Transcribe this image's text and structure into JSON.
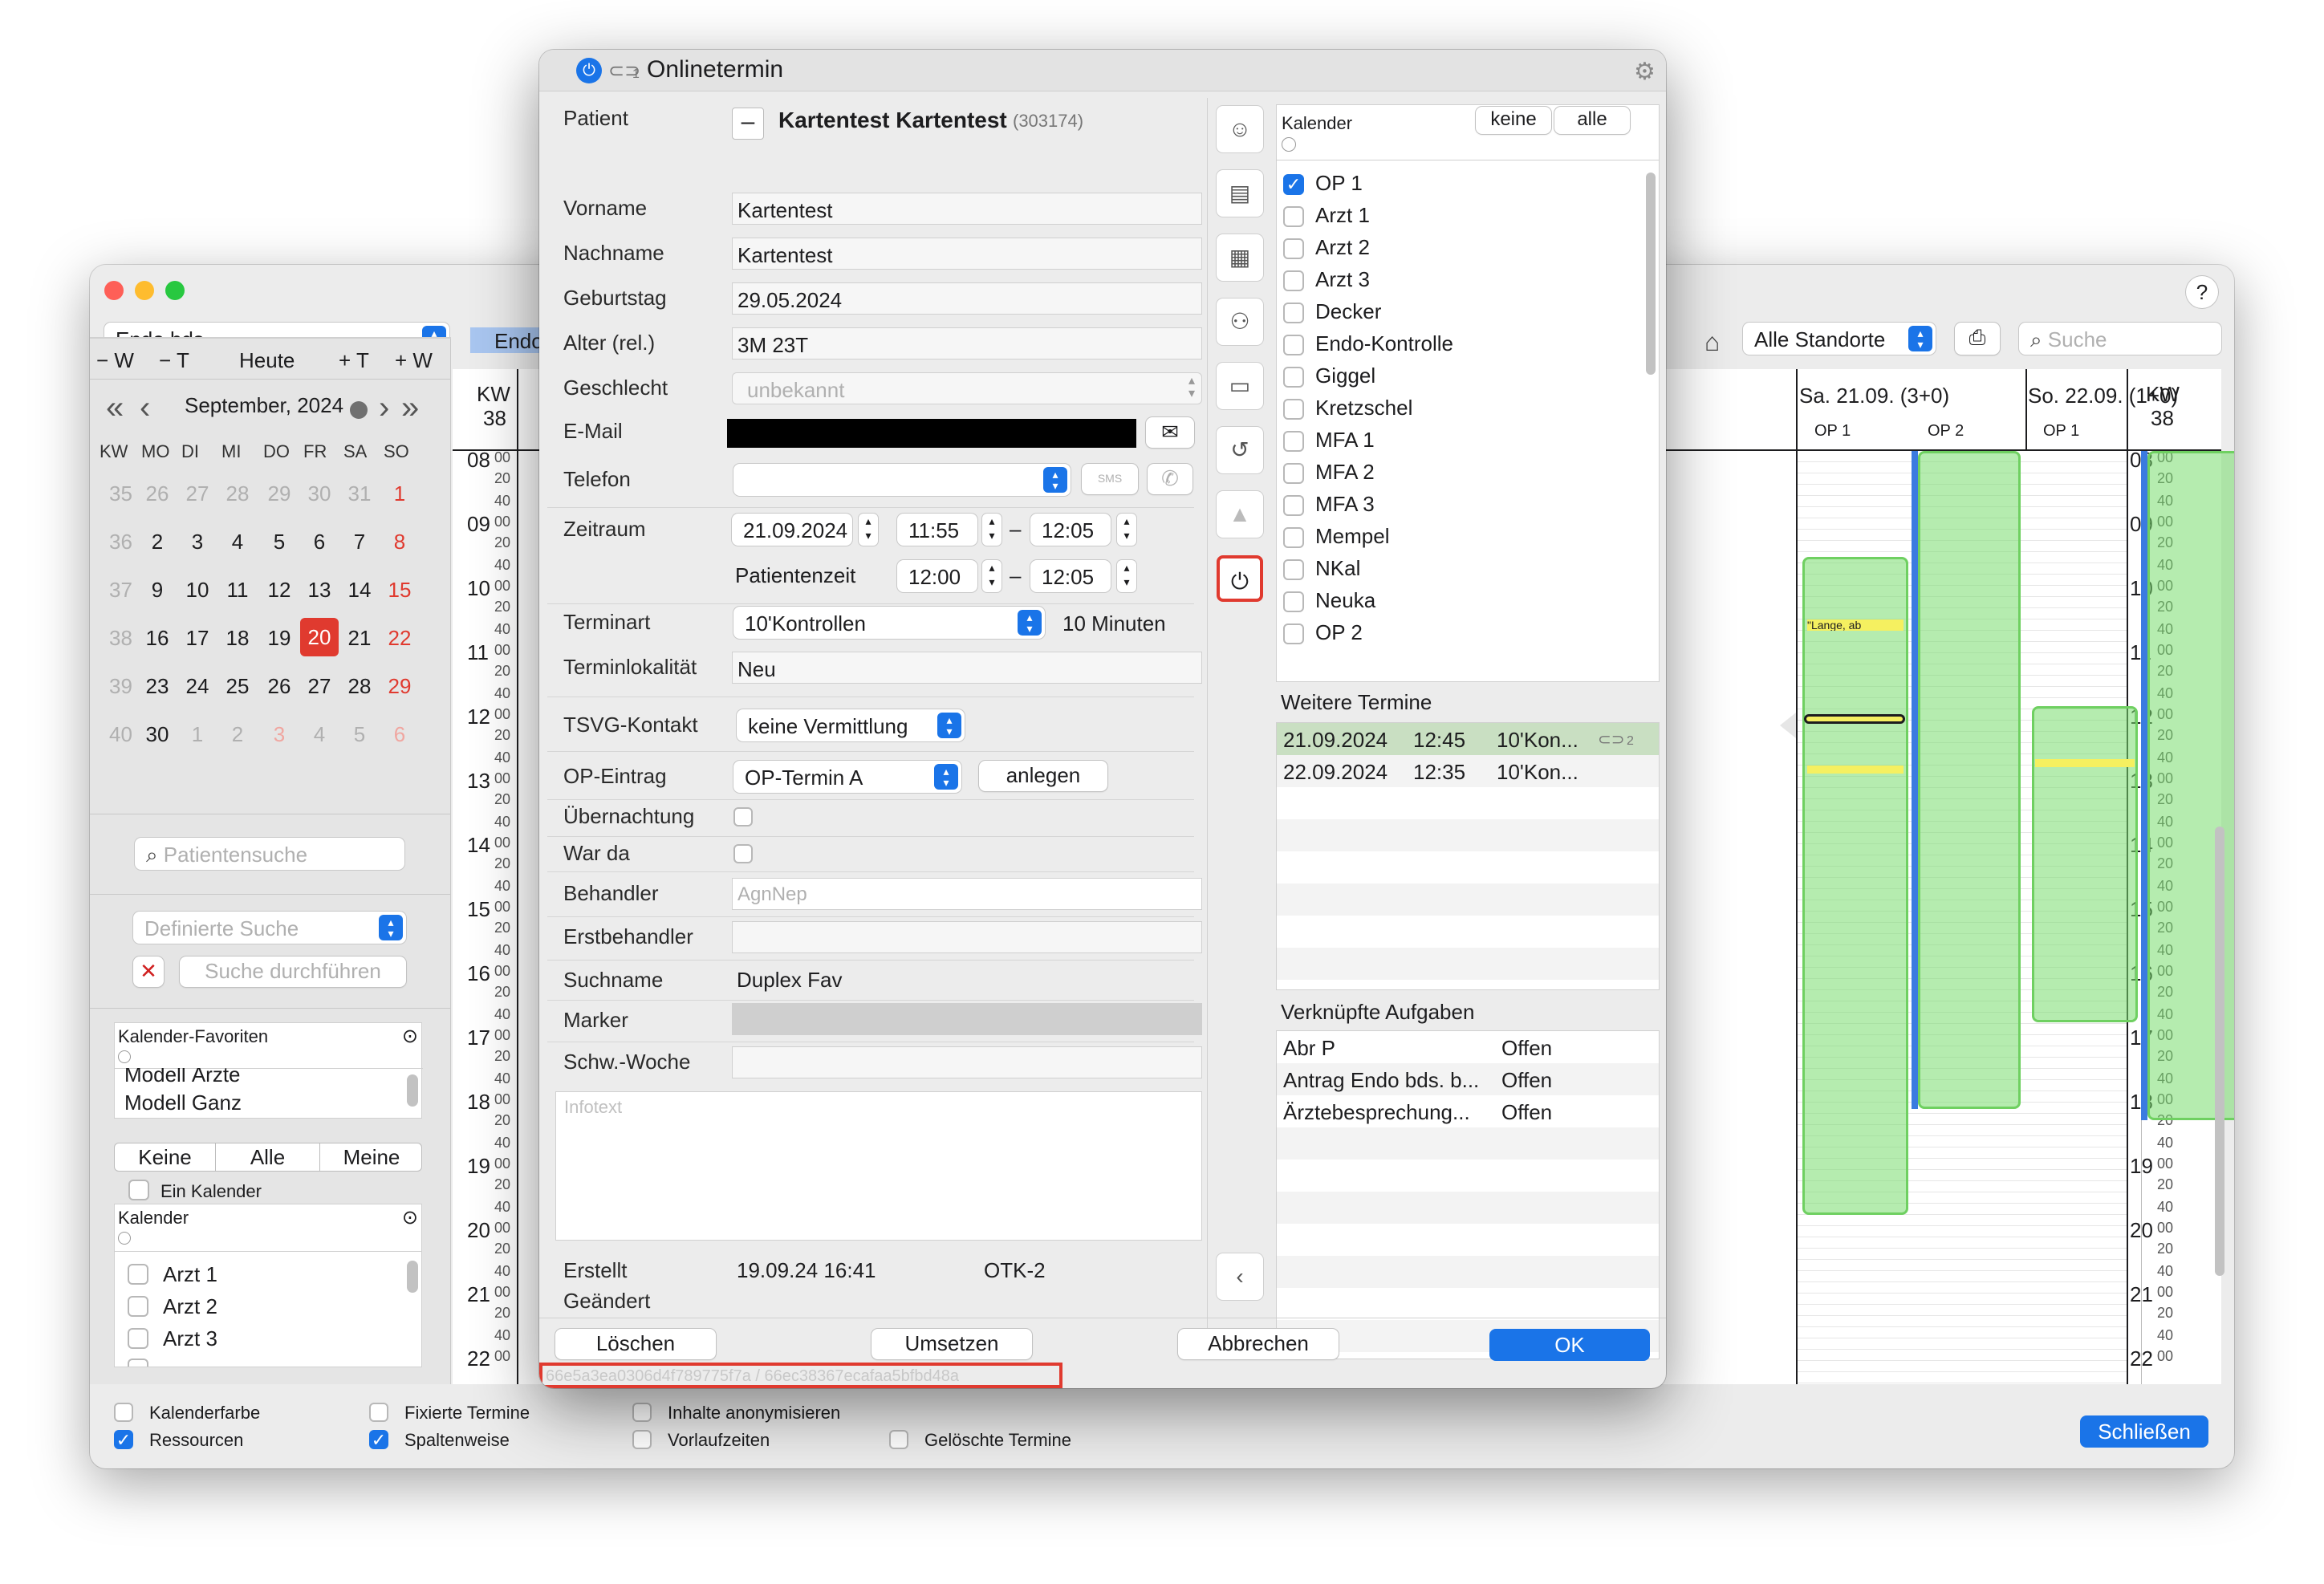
{
  "main": {
    "calendar_select": "Endo bds.",
    "calendar_tag": "Endo",
    "help": "?",
    "location_select": "Alle Standorte",
    "search_placeholder": "Suche",
    "nav": {
      "minus_w": "− W",
      "minus_t": "− T",
      "today": "Heute",
      "plus_t": "+ T",
      "plus_w": "+ W",
      "month": "September, 2024"
    },
    "weekday_headers": [
      "KW",
      "MO",
      "DI",
      "MI",
      "DO",
      "FR",
      "SA",
      "SO"
    ],
    "weeks": [
      {
        "kw": "35",
        "days": [
          "26",
          "27",
          "28",
          "29",
          "30",
          "31",
          "1"
        ]
      },
      {
        "kw": "36",
        "days": [
          "2",
          "3",
          "4",
          "5",
          "6",
          "7",
          "8"
        ]
      },
      {
        "kw": "37",
        "days": [
          "9",
          "10",
          "11",
          "12",
          "13",
          "14",
          "15"
        ]
      },
      {
        "kw": "38",
        "days": [
          "16",
          "17",
          "18",
          "19",
          "20",
          "21",
          "22"
        ]
      },
      {
        "kw": "39",
        "days": [
          "23",
          "24",
          "25",
          "26",
          "27",
          "28",
          "29"
        ]
      },
      {
        "kw": "40",
        "days": [
          "30",
          "1",
          "2",
          "3",
          "4",
          "5",
          "6"
        ]
      }
    ],
    "selected_day": "20",
    "patient_search_placeholder": "Patientensuche",
    "defined_search_placeholder": "Definierte Suche",
    "run_search": "Suche durchführen",
    "favorites_header": "Kalender-Favoriten",
    "favorites": [
      "Modell Ärzte",
      "Modell Ganz"
    ],
    "filter_buttons": [
      "Keine",
      "Alle",
      "Meine"
    ],
    "one_calendar": "Ein Kalender",
    "calendar_header": "Kalender",
    "calendar_items": [
      "Arzt 1",
      "Arzt 2",
      "Arzt 3"
    ],
    "kw_label": "KW",
    "kw_number": "38",
    "hours": [
      "08",
      "09",
      "10",
      "11",
      "12",
      "13",
      "14",
      "15",
      "16",
      "17",
      "18",
      "19",
      "20",
      "21",
      "22"
    ],
    "day_headers": [
      "Sa. 21.09. (3+0)",
      "So. 22.09. (1+0)"
    ],
    "resources": [
      "OP 1",
      "OP 2"
    ],
    "appt_label": "\"Lange, ab",
    "footer_options": [
      {
        "label": "Kalenderfarbe",
        "checked": false
      },
      {
        "label": "Fixierte Termine",
        "checked": false
      },
      {
        "label": "Inhalte anonymisieren",
        "checked": false
      },
      {
        "label": "Ressourcen",
        "checked": true
      },
      {
        "label": "Spaltenweise",
        "checked": true
      },
      {
        "label": "Vorlaufzeiten",
        "checked": false
      },
      {
        "label": "Gelöschte Termine",
        "checked": false
      }
    ],
    "close_button": "Schließen"
  },
  "dialog": {
    "title": "Onlinetermin",
    "link_count": "1",
    "patient_label": "Patient",
    "patient_name": "Kartentest Kartentest",
    "patient_id": "(303174)",
    "fields": {
      "vorname_label": "Vorname",
      "vorname": "Kartentest",
      "nachname_label": "Nachname",
      "nachname": "Kartentest",
      "geburtstag_label": "Geburtstag",
      "geburtstag": "29.05.2024",
      "alter_label": "Alter (rel.)",
      "alter": "3M 23T",
      "geschlecht_label": "Geschlecht",
      "geschlecht": "unbekannt",
      "email_label": "E-Mail",
      "telefon_label": "Telefon",
      "sms": "SMS",
      "zeitraum_label": "Zeitraum",
      "date": "21.09.2024",
      "start": "11:55",
      "end": "12:05",
      "patientenzeit_label": "Patientenzeit",
      "pt_start": "12:00",
      "pt_end": "12:05",
      "terminart_label": "Terminart",
      "terminart": "10'Kontrollen",
      "duration": "10 Minuten",
      "lokalitaet_label": "Terminlokalität",
      "lokalitaet": "Neu",
      "tsvg_label": "TSVG-Kontakt",
      "tsvg": "keine Vermittlung",
      "op_label": "OP-Eintrag",
      "op": "OP-Termin A",
      "anlegen": "anlegen",
      "uebernachtung_label": "Übernachtung",
      "warda_label": "War da",
      "behandler_label": "Behandler",
      "behandler_placeholder": "AgnNep",
      "erstbehandler_label": "Erstbehandler",
      "suchname_label": "Suchname",
      "suchname": "Duplex Fav",
      "marker_label": "Marker",
      "schwoche_label": "Schw.-Woche",
      "infotext_placeholder": "Infotext",
      "erstellt_label": "Erstellt",
      "erstellt": "19.09.24 16:41",
      "erstellt_by": "OTK-2",
      "geaendert_label": "Geändert"
    },
    "buttons": {
      "delete": "Löschen",
      "move": "Umsetzen",
      "cancel": "Abbrechen",
      "ok": "OK"
    },
    "hash": "66e5a3ea0306d4f789775f7a / 66ec38367ecafaa5bfbd48a",
    "kal_header": "Kalender",
    "kal_keine": "keine",
    "kal_alle": "alle",
    "kal_items": [
      {
        "label": "OP 1",
        "checked": true
      },
      {
        "label": "Arzt 1",
        "checked": false
      },
      {
        "label": "Arzt 2",
        "checked": false
      },
      {
        "label": "Arzt 3",
        "checked": false
      },
      {
        "label": "Decker",
        "checked": false
      },
      {
        "label": "Endo-Kontrolle",
        "checked": false
      },
      {
        "label": "Giggel",
        "checked": false
      },
      {
        "label": "Kretzschel",
        "checked": false
      },
      {
        "label": "MFA 1",
        "checked": false
      },
      {
        "label": "MFA 2",
        "checked": false
      },
      {
        "label": "MFA 3",
        "checked": false
      },
      {
        "label": "Mempel",
        "checked": false
      },
      {
        "label": "NKal",
        "checked": false
      },
      {
        "label": "Neuka",
        "checked": false
      },
      {
        "label": "OP 2",
        "checked": false
      }
    ],
    "weitere_header": "Weitere Termine",
    "weitere": [
      {
        "date": "21.09.2024",
        "time": "12:45",
        "type": "10'Kon...",
        "links": "2"
      },
      {
        "date": "22.09.2024",
        "time": "12:35",
        "type": "10'Kon...",
        "links": ""
      }
    ],
    "aufgaben_header": "Verknüpfte Aufgaben",
    "aufgaben": [
      {
        "name": "Abr P",
        "status": "Offen"
      },
      {
        "name": "Antrag Endo bds. b...",
        "status": "Offen"
      },
      {
        "name": "Ärztebesprechung...",
        "status": "Offen"
      }
    ]
  }
}
